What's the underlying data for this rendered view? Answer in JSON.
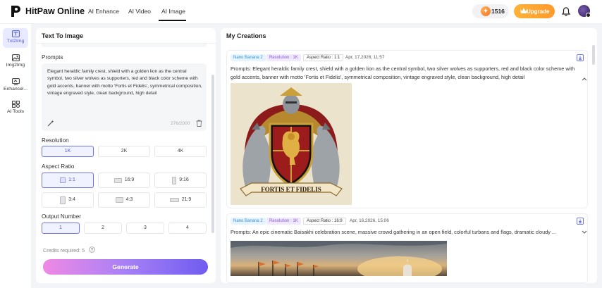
{
  "header": {
    "brand": "HitPaw Online",
    "nav": [
      "AI Enhance",
      "AI Video",
      "AI Image"
    ],
    "active_nav": "AI Image",
    "credits": "1516",
    "upgrade_label": "Upgrade"
  },
  "sidebar": {
    "items": [
      {
        "label": "Txt2Img",
        "icon": "text-image-icon",
        "active": true
      },
      {
        "label": "Img2Img",
        "icon": "image-image-icon",
        "active": false
      },
      {
        "label": "Enhancel...",
        "icon": "enhance-icon",
        "active": false
      },
      {
        "label": "AI Tools",
        "icon": "tools-icon",
        "active": false
      }
    ]
  },
  "left_panel": {
    "title": "Text To Image",
    "prompts_label": "Prompts",
    "prompt_text": "Elegant heraldic family crest, shield with a golden lion as the central symbol, two silver wolves as supporters, red and black color scheme with gold accents, banner with motto 'Fortis et Fidelis', symmetrical composition, vintage engraved style, clean background, high detail",
    "char_count": "276/2000",
    "resolution_label": "Resolution",
    "resolutions": [
      "1K",
      "2K",
      "4K"
    ],
    "selected_resolution": "1K",
    "aspect_label": "Aspect Ratio",
    "aspects": [
      "1:1",
      "16:9",
      "9:16",
      "3:4",
      "4:3",
      "21:9"
    ],
    "selected_aspect": "1:1",
    "output_label": "Output Number",
    "outputs": [
      "1",
      "2",
      "3",
      "4"
    ],
    "selected_output": "1",
    "credits_required": "Credits required: 5",
    "generate_label": "Generate"
  },
  "right_panel": {
    "title": "My Creations",
    "creations": [
      {
        "model": "Nano Banana 2",
        "resolution": "Resolution : 1K",
        "aspect": "Aspect Ratio : 1:1",
        "date": "Apr, 17,2026, 11:57",
        "prompt": "Prompts: Elegant heraldic family crest, shield with a golden lion as the central symbol, two silver wolves as supporters, red and black color scheme with gold accents, banner with motto 'Fortis et Fidelis', symmetrical composition, vintage engraved style, clean background, high detail",
        "motto": "FORTIS ET FIDELIS"
      },
      {
        "model": "Nano Banana 2",
        "resolution": "Resolution : 1K",
        "aspect": "Aspect Ratio : 16:9",
        "date": "Apr, 16,2026, 15:06",
        "prompt": "Prompts: An epic cinematic Baisakhi celebration scene, massive crowd gathering in an open field, colorful turbans and flags, dramatic cloudy ..."
      }
    ]
  },
  "colors": {
    "accent": "#4a55e0",
    "upgrade": "#ffa530",
    "generate_start": "#f089e5",
    "generate_end": "#6f5cf0"
  }
}
